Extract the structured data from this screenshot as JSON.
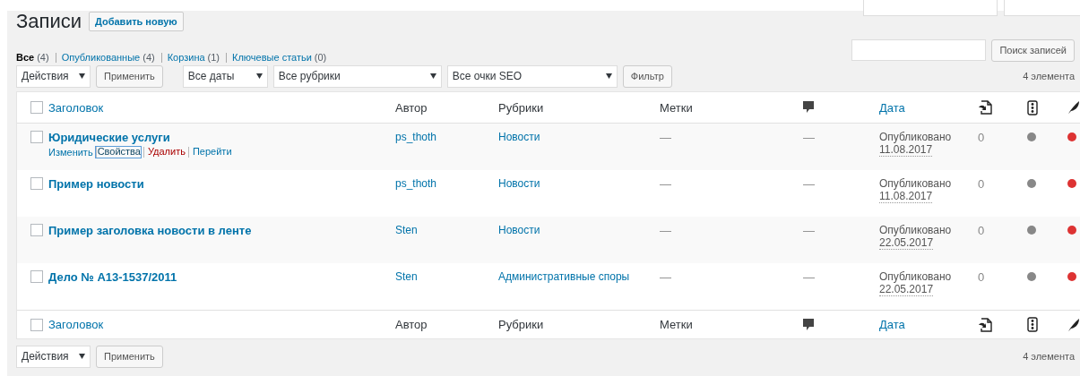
{
  "page_title": "Записи",
  "add_button": "Добавить новую",
  "status_links": [
    {
      "label": "Все",
      "count": "(4)",
      "selected": true
    },
    {
      "label": "Опубликованные",
      "count": "(4)",
      "selected": false
    },
    {
      "label": "Корзина",
      "count": "(1)",
      "selected": false
    },
    {
      "label": "Ключевые статьи",
      "count": "(0)",
      "selected": false
    }
  ],
  "search": {
    "button": "Поиск записей"
  },
  "top_actions": {
    "bulk": "Действия",
    "apply": "Применить",
    "filters": [
      {
        "label": "Все даты",
        "kind": "short"
      },
      {
        "label": "Все рубрики",
        "kind": "long"
      },
      {
        "label": "Все очки SEO",
        "kind": "medium"
      }
    ],
    "filter_button": "Фильтр",
    "count": "4 элемента"
  },
  "columns": [
    {
      "kind": "check",
      "checked": false
    },
    {
      "kind": "text",
      "label": "Заголовок",
      "sortable": true
    },
    {
      "kind": "text",
      "label": "Автор",
      "sortable": false
    },
    {
      "kind": "text",
      "label": "Рубрики",
      "sortable": false
    },
    {
      "kind": "text",
      "label": "Метки",
      "sortable": false
    },
    {
      "kind": "comments"
    },
    {
      "kind": "text",
      "label": "Дата",
      "sortable": true
    },
    {
      "kind": "links"
    },
    {
      "kind": "readability"
    },
    {
      "kind": "keyphrase"
    }
  ],
  "footer_columns": [
    {
      "kind": "check",
      "checked": false
    },
    {
      "kind": "text",
      "label": "Заголовок",
      "sortable": true
    },
    {
      "kind": "text",
      "label": "Автор",
      "sortable": false
    },
    {
      "kind": "text",
      "label": "Рубрики",
      "sortable": false
    },
    {
      "kind": "text",
      "label": "Метки",
      "sortable": false
    },
    {
      "kind": "comments"
    },
    {
      "kind": "text",
      "label": "Дата",
      "sortable": true
    },
    {
      "kind": "links"
    },
    {
      "kind": "readability"
    },
    {
      "kind": "keyphrase"
    }
  ],
  "rows": [
    {
      "checked": false,
      "title": "Юридические услуги",
      "actions": [
        {
          "label": "Изменить",
          "kind": "link",
          "focused": false
        },
        {
          "label": "Свойства",
          "kind": "link",
          "focused": true
        },
        {
          "label": "Удалить",
          "kind": "delete",
          "focused": false
        },
        {
          "label": "Перейти",
          "kind": "link",
          "focused": false
        }
      ],
      "author": "ps_thoth",
      "category": "Новости",
      "tags": "—",
      "comments": "—",
      "status": "Опубликовано",
      "date": "11.08.2017",
      "links": "0",
      "dots": [
        {
          "color": "#888888"
        },
        {
          "color": "#dd3333"
        }
      ]
    },
    {
      "checked": false,
      "title": "Пример новости",
      "actions": [],
      "author": "ps_thoth",
      "category": "Новости",
      "tags": "—",
      "comments": "—",
      "status": "Опубликовано",
      "date": "11.08.2017",
      "links": "0",
      "dots": [
        {
          "color": "#888888"
        },
        {
          "color": "#dd3333"
        }
      ]
    },
    {
      "checked": false,
      "title": "Пример заголовка новости в ленте",
      "actions": [],
      "author": "Sten",
      "category": "Новости",
      "tags": "—",
      "comments": "—",
      "status": "Опубликовано",
      "date": "22.05.2017",
      "links": "0",
      "dots": [
        {
          "color": "#888888"
        },
        {
          "color": "#dd3333"
        }
      ]
    },
    {
      "checked": false,
      "title": "Дело № А13-1537/2011",
      "actions": [],
      "author": "Sten",
      "category": "Административные споры",
      "tags": "—",
      "comments": "—",
      "status": "Опубликовано",
      "date": "22.05.2017",
      "links": "0",
      "dots": [
        {
          "color": "#888888"
        },
        {
          "color": "#dd3333"
        }
      ]
    }
  ],
  "bottom_actions": {
    "bulk": "Действия",
    "apply": "Применить",
    "count": "4 элемента"
  }
}
